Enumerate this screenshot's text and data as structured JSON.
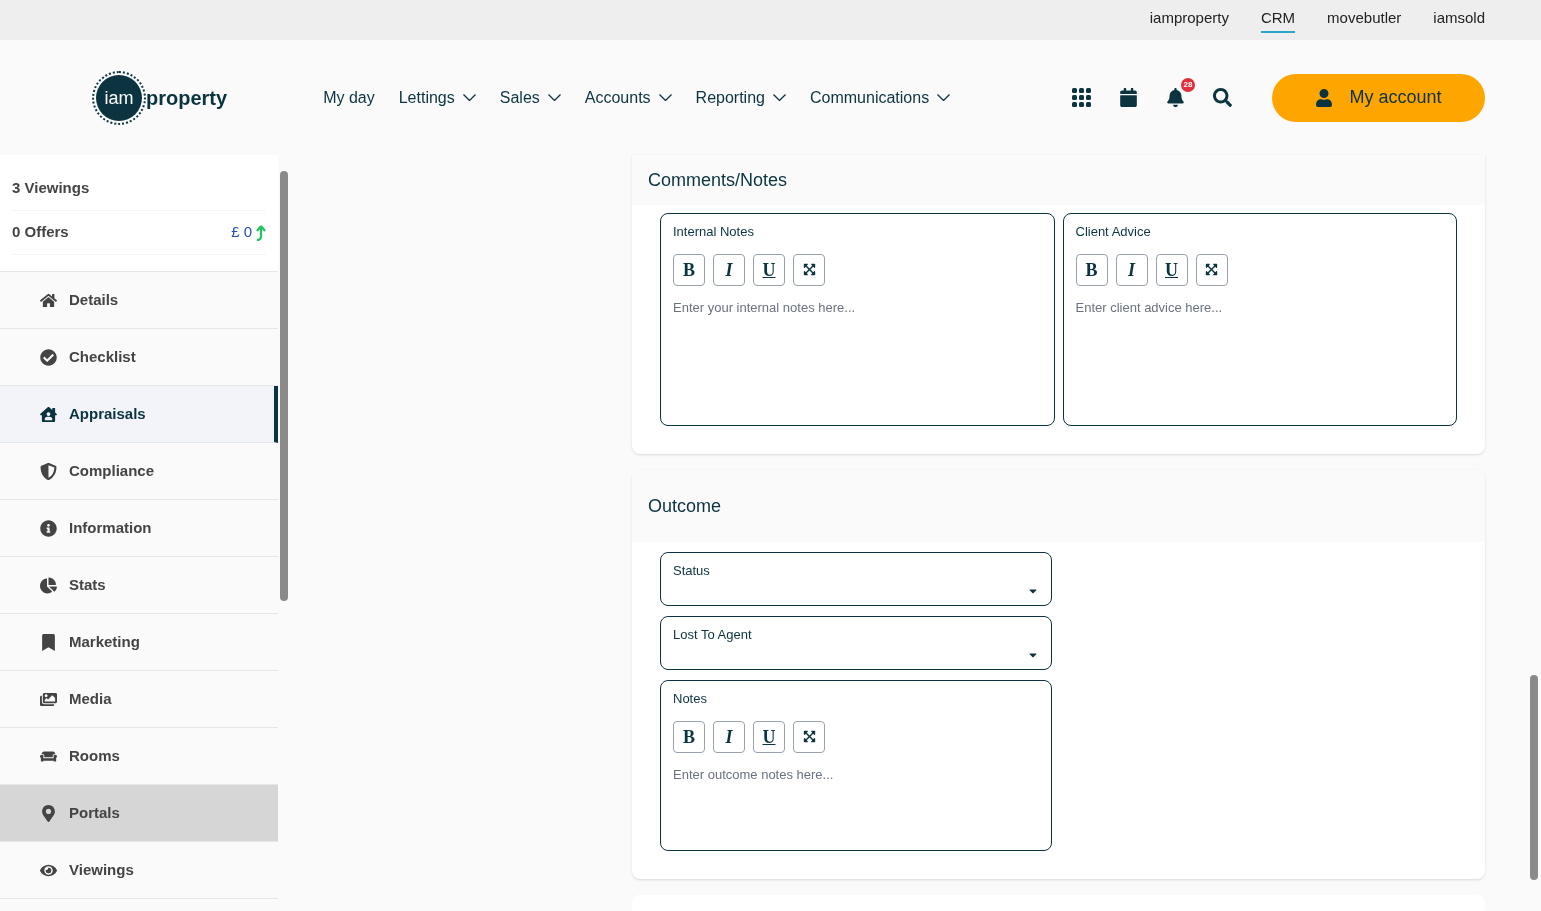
{
  "top_links": [
    {
      "label": "iamproperty",
      "selected": false
    },
    {
      "label": "CRM",
      "selected": true
    },
    {
      "label": "movebutler",
      "selected": false
    },
    {
      "label": "iamsold",
      "selected": false
    }
  ],
  "logo": {
    "mark": "iam",
    "word": "property"
  },
  "nav": [
    {
      "label": "My day",
      "dropdown": false
    },
    {
      "label": "Lettings",
      "dropdown": true
    },
    {
      "label": "Sales",
      "dropdown": true
    },
    {
      "label": "Accounts",
      "dropdown": true
    },
    {
      "label": "Reporting",
      "dropdown": true
    },
    {
      "label": "Communications",
      "dropdown": true
    }
  ],
  "notifications_badge": "28",
  "account_button": "My account",
  "summary": {
    "viewings": "3 Viewings",
    "offers": "0 Offers",
    "offer_value": "£ 0"
  },
  "sidebar": [
    {
      "label": "Details",
      "selected": false,
      "highlighted": false
    },
    {
      "label": "Checklist",
      "selected": false,
      "highlighted": false
    },
    {
      "label": "Appraisals",
      "selected": true,
      "highlighted": false
    },
    {
      "label": "Compliance",
      "selected": false,
      "highlighted": false
    },
    {
      "label": "Information",
      "selected": false,
      "highlighted": false
    },
    {
      "label": "Stats",
      "selected": false,
      "highlighted": false
    },
    {
      "label": "Marketing",
      "selected": false,
      "highlighted": false
    },
    {
      "label": "Media",
      "selected": false,
      "highlighted": false
    },
    {
      "label": "Rooms",
      "selected": false,
      "highlighted": false
    },
    {
      "label": "Portals",
      "selected": false,
      "highlighted": true
    },
    {
      "label": "Viewings",
      "selected": false,
      "highlighted": false
    }
  ],
  "comments": {
    "title": "Comments/Notes",
    "editors": [
      {
        "label": "Internal Notes",
        "toolbar": [
          "B",
          "I",
          "U"
        ],
        "placeholder": "Enter your internal notes here..."
      },
      {
        "label": "Client Advice",
        "toolbar": [
          "B",
          "I",
          "U"
        ],
        "placeholder": "Enter client advice here..."
      }
    ]
  },
  "outcome": {
    "title": "Outcome",
    "fields": [
      {
        "kind": "select",
        "label": "Status"
      },
      {
        "kind": "select",
        "label": "Lost To Agent"
      },
      {
        "kind": "editor",
        "label": "Notes",
        "toolbar": [
          "B",
          "I",
          "U"
        ],
        "placeholder": "Enter outcome notes here..."
      }
    ]
  }
}
